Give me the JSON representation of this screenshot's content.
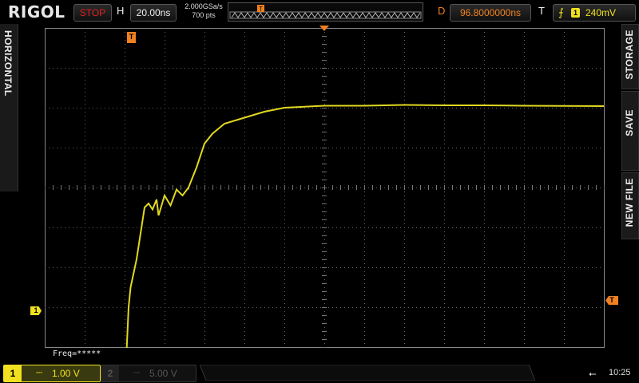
{
  "header": {
    "brand": "RIGOL",
    "run_state": "STOP",
    "h_label": "H",
    "timebase": "20.00ns",
    "sample_rate": "2.000GSa/s",
    "mem_depth": "700  pts",
    "d_label": "D",
    "delay": "96.8000000ns",
    "t_label": "T",
    "trigger_channel": "1",
    "trigger_level": "240mV"
  },
  "side_menus": {
    "left": "HORIZONTAL",
    "right": [
      "STORAGE",
      "SAVE",
      "NEW FILE"
    ]
  },
  "screen": {
    "ch1_marker": "1",
    "trigger_level_marker": "T",
    "trigger_pos_marker": "T",
    "measurement": "Freq=*****"
  },
  "channels": [
    {
      "number": "1",
      "coupling": "⎓",
      "scale": "1.00 V",
      "active": true
    },
    {
      "number": "2",
      "coupling": "⎓",
      "scale": "5.00 V",
      "active": false
    }
  ],
  "status": {
    "usb_icon": "usb-icon",
    "time": "10:25"
  },
  "colors": {
    "ch1": "#f0e020",
    "trigger": "#f08020",
    "stop": "#e02020"
  },
  "waveform": {
    "channel": "1",
    "x_unit": "div",
    "y_unit": "div",
    "points": [
      [
        0.0,
        -4.1
      ],
      [
        1.5,
        -4.1
      ],
      [
        1.65,
        -4.05
      ],
      [
        1.75,
        -4.15
      ],
      [
        1.85,
        -4.08
      ],
      [
        2.05,
        -4.1
      ],
      [
        2.1,
        -3.0
      ],
      [
        2.15,
        -2.5
      ],
      [
        2.3,
        -1.8
      ],
      [
        2.5,
        -0.5
      ],
      [
        2.6,
        -0.4
      ],
      [
        2.7,
        -0.55
      ],
      [
        2.8,
        -0.3
      ],
      [
        2.85,
        -0.7
      ],
      [
        3.0,
        -0.2
      ],
      [
        3.15,
        -0.45
      ],
      [
        3.3,
        -0.05
      ],
      [
        3.45,
        -0.2
      ],
      [
        3.6,
        0.0
      ],
      [
        3.8,
        0.5
      ],
      [
        4.0,
        1.1
      ],
      [
        4.2,
        1.35
      ],
      [
        4.5,
        1.6
      ],
      [
        5.0,
        1.75
      ],
      [
        5.5,
        1.9
      ],
      [
        6.0,
        2.0
      ],
      [
        7.0,
        2.05
      ],
      [
        8.0,
        2.05
      ],
      [
        9.0,
        2.07
      ],
      [
        10.0,
        2.06
      ],
      [
        11.0,
        2.06
      ],
      [
        12.0,
        2.05
      ],
      [
        14.0,
        2.04
      ]
    ]
  }
}
